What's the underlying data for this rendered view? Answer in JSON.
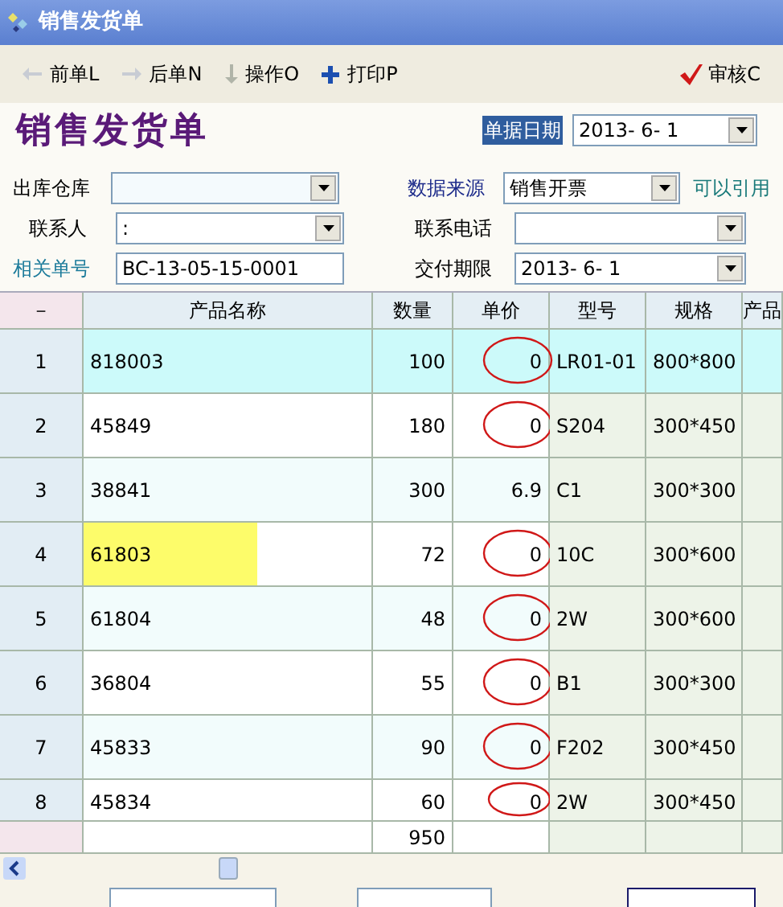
{
  "window": {
    "title": "销售发货单"
  },
  "toolbar": [
    {
      "label": "前单L",
      "kind": "prev"
    },
    {
      "label": "后单N",
      "kind": "next"
    },
    {
      "label": "操作O",
      "kind": "action"
    },
    {
      "label": "打印P",
      "kind": "print"
    }
  ],
  "approve_button": {
    "label": "审核C"
  },
  "heading": "销售发货单",
  "date_label": "单据日期",
  "date_value": "2013-  6-  1",
  "form": {
    "warehouse_label": "出库仓库",
    "source_label": "数据来源",
    "source_value": "销售开票",
    "source_hint": "可以引用",
    "contact_label": "联系人",
    "contact_value": ":",
    "phone_label": "联系电话",
    "ref_label": "相关单号",
    "ref_value": "BC-13-05-15-0001",
    "due_label": "交付期限",
    "due_value": "2013-  6-  1"
  },
  "table": {
    "columns": [
      "－",
      "产品名称",
      "数量",
      "单价",
      "型号",
      "规格",
      "产品"
    ],
    "rows": [
      {
        "cells": [
          "1",
          "818003",
          "100",
          "0",
          "LR01-01",
          "800*800"
        ],
        "selected": true,
        "highlight": false,
        "circled": true
      },
      {
        "cells": [
          "2",
          "45849",
          "180",
          "0",
          "S204",
          "300*450"
        ],
        "selected": false,
        "highlight": false,
        "circled": true
      },
      {
        "cells": [
          "3",
          "38841",
          "300",
          "6.9",
          "C1",
          "300*300"
        ],
        "selected": false,
        "highlight": false,
        "circled": false
      },
      {
        "cells": [
          "4",
          "61803",
          "72",
          "0",
          "10C",
          "300*600"
        ],
        "selected": false,
        "highlight": true,
        "circled": true
      },
      {
        "cells": [
          "5",
          "61804",
          "48",
          "0",
          "2W",
          "300*600"
        ],
        "selected": false,
        "highlight": false,
        "circled": true
      },
      {
        "cells": [
          "6",
          "36804",
          "55",
          "0",
          "B1",
          "300*300"
        ],
        "selected": false,
        "highlight": false,
        "circled": true
      },
      {
        "cells": [
          "7",
          "45833",
          "90",
          "0",
          "F202",
          "300*450"
        ],
        "selected": false,
        "highlight": false,
        "circled": true
      },
      {
        "cells": [
          "8",
          "45834",
          "60",
          "0",
          "2W",
          "300*450"
        ],
        "selected": false,
        "highlight": false,
        "circled": true
      }
    ],
    "total": "950"
  }
}
